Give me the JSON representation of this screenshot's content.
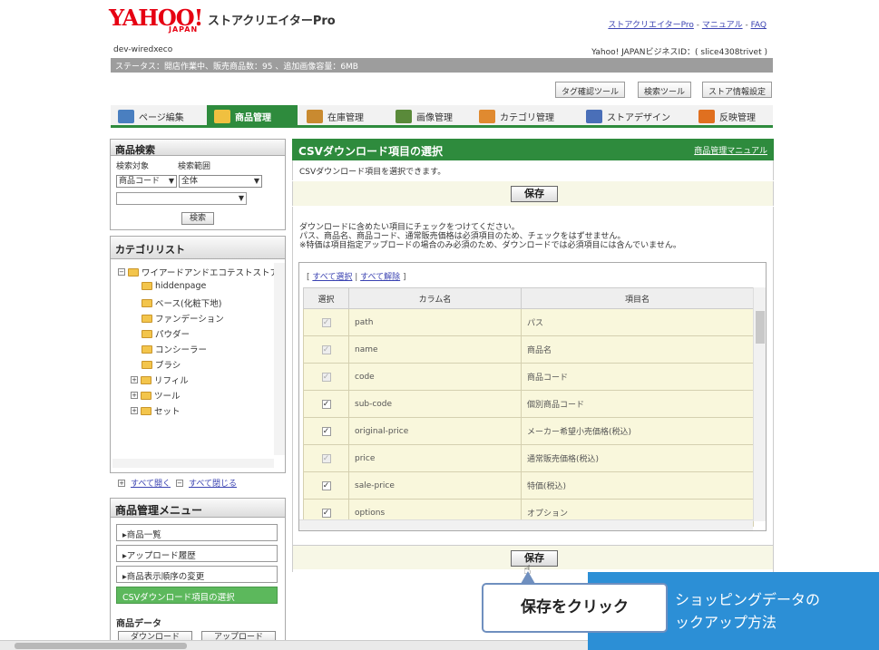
{
  "header": {
    "logo_text": "YAHOO!",
    "logo_sub": "JAPAN",
    "app_name": "ストアクリエイターPro",
    "links": [
      "ストアクリエイターPro",
      "マニュアル",
      "FAQ"
    ],
    "account": "dev-wiredxeco",
    "business_id": "Yahoo! JAPANビジネスID：( slice4308trivet )",
    "status": "ステータス：開店作業中、販売商品数：95 、追加画像容量：6MB"
  },
  "toolbar": [
    "タグ確認ツール",
    "検索ツール",
    "ストア情報設定"
  ],
  "nav": [
    {
      "label": "ページ編集",
      "active": false
    },
    {
      "label": "商品管理",
      "active": true
    },
    {
      "label": "在庫管理",
      "active": false
    },
    {
      "label": "画像管理",
      "active": false
    },
    {
      "label": "カテゴリ管理",
      "active": false
    },
    {
      "label": "ストアデザイン",
      "active": false
    },
    {
      "label": "反映管理",
      "active": false
    }
  ],
  "sidebar": {
    "search_title": "商品検索",
    "search_target_label": "検索対象",
    "search_range_label": "検索範囲",
    "search_target_value": "商品コード",
    "search_range_value": "全体",
    "search_button": "検索",
    "category_title": "カテゴリリスト",
    "categories": [
      "ワイアードアンドエコテストストア",
      "hiddenpage",
      "ベース(化粧下地)",
      "ファンデーション",
      "パウダー",
      "コンシーラー",
      "ブラシ",
      "リフィル",
      "ツール",
      "セット"
    ],
    "expand_all": "すべて開く",
    "collapse_all": "すべて閉じる",
    "menu_title": "商品管理メニュー",
    "menu_items": [
      "▸商品一覧",
      "▸アップロード履歴",
      "▸商品表示順序の変更",
      "CSVダウンロード項目の選択"
    ],
    "product_data_label": "商品データ",
    "download_button": "ダウンロード",
    "upload_button": "アップロード"
  },
  "main": {
    "title": "CSVダウンロード項目の選択",
    "manual_link": "商品管理マニュアル",
    "intro": "CSVダウンロード項目を選択できます。",
    "save_label": "保存",
    "instructions": [
      "ダウンロードに含めたい項目にチェックをつけてください。",
      "パス、商品名、商品コード、通常販売価格は必須項目のため、チェックをはずせません。",
      "※特価は項目指定アップロードの場合のみ必須のため、ダウンロードでは必須項目には含んでいません。"
    ],
    "select_all": "すべて選択",
    "deselect_all": "すべて解除",
    "columns": [
      "選択",
      "カラム名",
      "項目名"
    ],
    "rows": [
      {
        "column": "path",
        "item": "パス",
        "checked": true,
        "disabled": true
      },
      {
        "column": "name",
        "item": "商品名",
        "checked": true,
        "disabled": true
      },
      {
        "column": "code",
        "item": "商品コード",
        "checked": true,
        "disabled": true
      },
      {
        "column": "sub-code",
        "item": "個別商品コード",
        "checked": true,
        "disabled": false
      },
      {
        "column": "original-price",
        "item": "メーカー希望小売価格(税込)",
        "checked": true,
        "disabled": false
      },
      {
        "column": "price",
        "item": "通常販売価格(税込)",
        "checked": true,
        "disabled": true
      },
      {
        "column": "sale-price",
        "item": "特価(税込)",
        "checked": true,
        "disabled": false
      },
      {
        "column": "options",
        "item": "オプション",
        "checked": true,
        "disabled": false
      }
    ]
  },
  "overlay": {
    "callout": "保存をクリック",
    "banner_line1": "ショッピングデータの",
    "banner_line2": "ックアップ方法"
  }
}
